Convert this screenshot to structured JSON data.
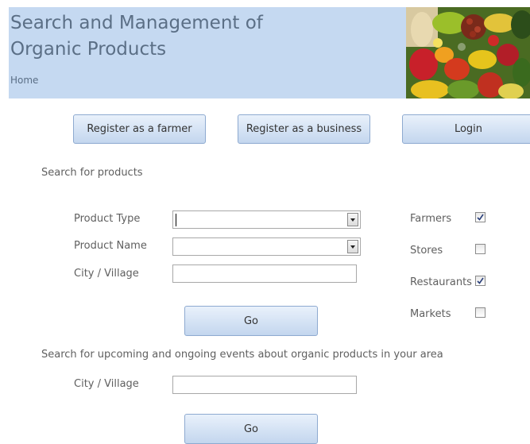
{
  "header": {
    "title": "Search and Management of\nOrganic Products",
    "home_link": "Home",
    "image_icon": "vegetables-photo",
    "background": "#c5d9f1"
  },
  "top_buttons": {
    "register_farmer": "Register as a farmer",
    "register_business": "Register as a business",
    "login": "Login"
  },
  "product_search": {
    "heading": "Search for products",
    "product_type_label": "Product Type",
    "product_type_value": "",
    "product_name_label": "Product Name",
    "product_name_value": "",
    "city_label": "City / Village",
    "city_value": "",
    "go_label": "Go"
  },
  "filters": [
    {
      "label": "Farmers",
      "checked": true
    },
    {
      "label": "Stores",
      "checked": false
    },
    {
      "label": "Restaurants",
      "checked": true
    },
    {
      "label": "Markets",
      "checked": false
    }
  ],
  "event_search": {
    "heading": "Search for upcoming and ongoing events about organic products in your area",
    "city_label": "City / Village",
    "city_value": "",
    "go_label": "Go"
  }
}
